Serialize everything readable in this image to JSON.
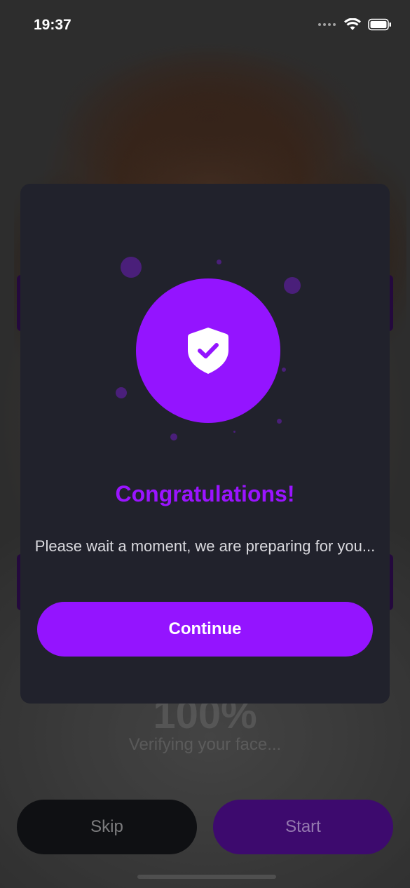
{
  "status_bar": {
    "time": "19:37"
  },
  "background_screen": {
    "progress_percent": "100%",
    "status_text": "Verifying your face...",
    "skip_label": "Skip",
    "start_label": "Start"
  },
  "modal": {
    "icon": "shield-check-icon",
    "title": "Congratulations!",
    "message": "Please wait a moment, we are preparing for you...",
    "continue_label": "Continue"
  },
  "colors": {
    "accent": "#9414ff",
    "modal_bg": "#21222c",
    "title": "#9a14ff"
  }
}
